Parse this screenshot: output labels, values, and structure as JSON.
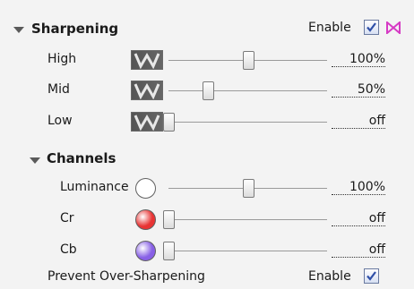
{
  "sharpening": {
    "title": "Sharpening",
    "enable_label": "Enable",
    "enabled": true,
    "rows": [
      {
        "label": "High",
        "value": "100%",
        "level": 0.5
      },
      {
        "label": "Mid",
        "value": "50%",
        "level": 0.25
      },
      {
        "label": "Low",
        "value": "off",
        "level": 0.0
      }
    ]
  },
  "channels": {
    "title": "Channels",
    "rows": [
      {
        "label": "Luminance",
        "value": "100%",
        "level": 0.5,
        "color": "#ffffff"
      },
      {
        "label": "Cr",
        "value": "off",
        "level": 0.0,
        "color": "#e83434"
      },
      {
        "label": "Cb",
        "value": "off",
        "level": 0.0,
        "color": "#8860e6"
      }
    ]
  },
  "prevent": {
    "label": "Prevent Over-Sharpening",
    "enable_label": "Enable",
    "enabled": true
  },
  "colors": {
    "accent_pink": "#d63ac4",
    "check_blue": "#2f4fa8"
  }
}
